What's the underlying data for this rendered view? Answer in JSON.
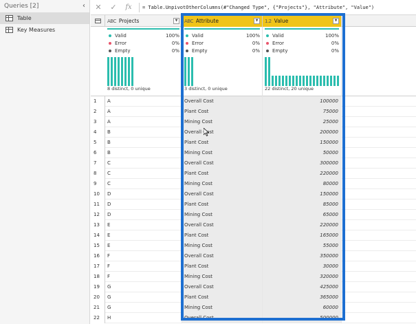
{
  "queries": {
    "header": "Queries [2]",
    "collapse_glyph": "‹",
    "items": [
      {
        "label": "Table",
        "selected": true
      },
      {
        "label": "Key Measures",
        "selected": false
      }
    ]
  },
  "formula_bar": {
    "cancel_glyph": "✕",
    "confirm_glyph": "✓",
    "fx_label": "fx",
    "formula": "= Table.UnpivotOtherColumns(#\"Changed Type\", {\"Projects\"}, \"Attribute\", \"Value\")"
  },
  "columns": [
    {
      "name": "Projects",
      "type_icon": "A͏B͏C",
      "selected": false,
      "valid_label": "Valid",
      "valid_pct": "100%",
      "error_label": "Error",
      "error_pct": "0%",
      "empty_label": "Empty",
      "empty_pct": "0%",
      "distinct_text": "8 distinct, 0 unique",
      "histogram": [
        1,
        1,
        1,
        1,
        1,
        1,
        1,
        1
      ]
    },
    {
      "name": "Attribute",
      "type_icon": "A͏B͏C",
      "selected": true,
      "valid_label": "Valid",
      "valid_pct": "100%",
      "error_label": "Error",
      "error_pct": "0%",
      "empty_label": "Empty",
      "empty_pct": "0%",
      "distinct_text": "3 distinct, 0 unique",
      "histogram": [
        1,
        1,
        1
      ]
    },
    {
      "name": "Value",
      "type_icon": "1.2",
      "selected": true,
      "valid_label": "Valid",
      "valid_pct": "100%",
      "error_label": "Error",
      "error_pct": "0%",
      "empty_label": "Empty",
      "empty_pct": "0%",
      "distinct_text": "22 distinct, 20 unique",
      "histogram": [
        1,
        1,
        0.35,
        0.35,
        0.35,
        0.35,
        0.35,
        0.35,
        0.35,
        0.35,
        0.35,
        0.35,
        0.35,
        0.35,
        0.35,
        0.35,
        0.35,
        0.35,
        0.35,
        0.35,
        0.35,
        0.35
      ]
    }
  ],
  "rows": [
    {
      "n": "1",
      "project": "A",
      "attribute": "Overall Cost",
      "value": "100000"
    },
    {
      "n": "2",
      "project": "A",
      "attribute": "Plant Cost",
      "value": "75000"
    },
    {
      "n": "3",
      "project": "A",
      "attribute": "Mining Cost",
      "value": "25000"
    },
    {
      "n": "4",
      "project": "B",
      "attribute": "Overall Cost",
      "value": "200000"
    },
    {
      "n": "5",
      "project": "B",
      "attribute": "Plant Cost",
      "value": "150000"
    },
    {
      "n": "6",
      "project": "B",
      "attribute": "Mining Cost",
      "value": "50000"
    },
    {
      "n": "7",
      "project": "C",
      "attribute": "Overall Cost",
      "value": "300000"
    },
    {
      "n": "8",
      "project": "C",
      "attribute": "Plant Cost",
      "value": "220000"
    },
    {
      "n": "9",
      "project": "C",
      "attribute": "Mining Cost",
      "value": "80000"
    },
    {
      "n": "10",
      "project": "D",
      "attribute": "Overall Cost",
      "value": "150000"
    },
    {
      "n": "11",
      "project": "D",
      "attribute": "Plant Cost",
      "value": "85000"
    },
    {
      "n": "12",
      "project": "D",
      "attribute": "Mining Cost",
      "value": "65000"
    },
    {
      "n": "13",
      "project": "E",
      "attribute": "Overall Cost",
      "value": "220000"
    },
    {
      "n": "14",
      "project": "E",
      "attribute": "Plant Cost",
      "value": "165000"
    },
    {
      "n": "15",
      "project": "E",
      "attribute": "Mining Cost",
      "value": "55000"
    },
    {
      "n": "16",
      "project": "F",
      "attribute": "Overall Cost",
      "value": "350000"
    },
    {
      "n": "17",
      "project": "F",
      "attribute": "Plant Cost",
      "value": "30000"
    },
    {
      "n": "18",
      "project": "F",
      "attribute": "Mining Cost",
      "value": "320000"
    },
    {
      "n": "19",
      "project": "G",
      "attribute": "Overall Cost",
      "value": "425000"
    },
    {
      "n": "20",
      "project": "G",
      "attribute": "Plant Cost",
      "value": "365000"
    },
    {
      "n": "21",
      "project": "G",
      "attribute": "Mining Cost",
      "value": "60000"
    },
    {
      "n": "22",
      "project": "H",
      "attribute": "Overall Cost",
      "value": "500000"
    }
  ],
  "colors": {
    "accent_teal": "#2bbdae",
    "header_selected": "#f0c419",
    "frame_blue": "#1d6fd1",
    "error_dot": "#e8556b",
    "empty_dot": "#555555"
  }
}
